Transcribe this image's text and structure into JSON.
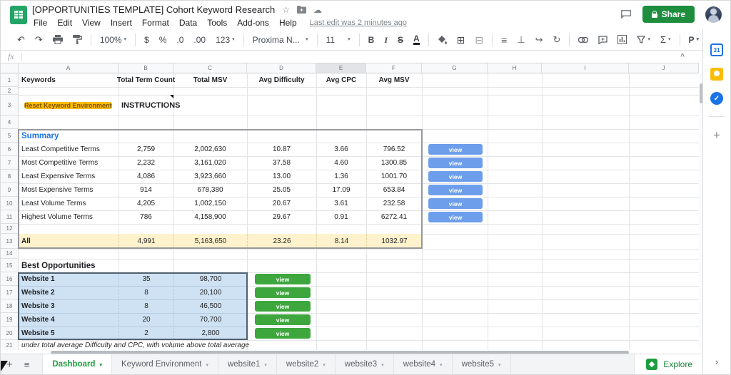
{
  "app": {
    "title": "[OPPORTUNITIES TEMPLATE] Cohort Keyword Research",
    "menu_items": [
      "File",
      "Edit",
      "View",
      "Insert",
      "Format",
      "Data",
      "Tools",
      "Add-ons",
      "Help"
    ],
    "last_edit": "Last edit was 2 minutes ago",
    "share_label": "Share"
  },
  "toolbar": {
    "zoom_value": "100%",
    "currency": "$",
    "percent": "%",
    "decimal_decrease": ".0",
    "decimal_increase": ".00",
    "number_format": "123",
    "font_name": "Proxima N...",
    "font_size": "11",
    "bold": "B",
    "italic": "I",
    "strikethrough": "S",
    "text_color": "A",
    "functions": "Σ",
    "addon": "P"
  },
  "formula_bar": {
    "label": "fx",
    "collapse": "^"
  },
  "grid": {
    "column_letters": [
      "A",
      "B",
      "C",
      "D",
      "E",
      "F",
      "G",
      "H",
      "I",
      "J"
    ],
    "selected_column": "E",
    "row_numbers": [
      "1",
      "2",
      "3",
      "4",
      "5",
      "6",
      "7",
      "8",
      "9",
      "10",
      "11",
      "12",
      "13",
      "14",
      "15",
      "16",
      "17",
      "18",
      "19",
      "20",
      "21"
    ]
  },
  "sheet": {
    "header_row": [
      "Keywords",
      "Total Term Count",
      "Total MSV",
      "Avg Difficulty",
      "Avg CPC",
      "Avg MSV"
    ],
    "reset_button_label": "Reset Keyword Environment",
    "instructions_label": "INSTRUCTIONS",
    "summary_title": "Summary",
    "view_button_label": "view",
    "summary_rows": [
      {
        "label": "Least Competitive Terms",
        "term_count": "2,759",
        "total_msv": "2,002,630",
        "avg_difficulty": "10.87",
        "avg_cpc": "3.66",
        "avg_msv": "796.52"
      },
      {
        "label": "Most Competitive Terms",
        "term_count": "2,232",
        "total_msv": "3,161,020",
        "avg_difficulty": "37.58",
        "avg_cpc": "4.60",
        "avg_msv": "1300.85"
      },
      {
        "label": "Least Expensive Terms",
        "term_count": "4,086",
        "total_msv": "3,923,660",
        "avg_difficulty": "13.00",
        "avg_cpc": "1.36",
        "avg_msv": "1001.70"
      },
      {
        "label": "Most Expensive Terms",
        "term_count": "914",
        "total_msv": "678,380",
        "avg_difficulty": "25.05",
        "avg_cpc": "17.09",
        "avg_msv": "653.84"
      },
      {
        "label": "Least Volume Terms",
        "term_count": "4,205",
        "total_msv": "1,002,150",
        "avg_difficulty": "20.67",
        "avg_cpc": "3.61",
        "avg_msv": "232.58"
      },
      {
        "label": "Highest Volume Terms",
        "term_count": "786",
        "total_msv": "4,158,900",
        "avg_difficulty": "29.67",
        "avg_cpc": "0.91",
        "avg_msv": "6272.41"
      }
    ],
    "all_row": {
      "label": "All",
      "term_count": "4,991",
      "total_msv": "5,163,650",
      "avg_difficulty": "23.26",
      "avg_cpc": "8.14",
      "avg_msv": "1032.97"
    },
    "best_title": "Best Opportunities",
    "best_rows": [
      {
        "label": "Website 1",
        "term_count": "35",
        "total_msv": "98,700"
      },
      {
        "label": "Website 2",
        "term_count": "8",
        "total_msv": "20,100"
      },
      {
        "label": "Website 3",
        "term_count": "8",
        "total_msv": "46,500"
      },
      {
        "label": "Website 4",
        "term_count": "20",
        "total_msv": "70,700"
      },
      {
        "label": "Website 5",
        "term_count": "2",
        "total_msv": "2,800"
      }
    ],
    "footnote": "under total average Difficulty and CPC, with volume above total average"
  },
  "tabs": {
    "items": [
      {
        "label": "Dashboard"
      },
      {
        "label": "Keyword Environment"
      },
      {
        "label": "website1"
      },
      {
        "label": "website2"
      },
      {
        "label": "website3"
      },
      {
        "label": "website4"
      },
      {
        "label": "website5"
      }
    ],
    "active_tab": "Dashboard"
  },
  "explore": {
    "label": "Explore"
  },
  "sidebar": {
    "calendar": "31",
    "tasks_check": "✓"
  },
  "colors": {
    "share_green": "#1e8e3e",
    "tab_active_green": "#1d9e3c",
    "summary_blue": "#1a73e8",
    "view_button_blue": "#6d9eeb",
    "view_button_green": "#3da63d",
    "reset_button_yellow": "#fbbc04",
    "all_row_background": "#fff2cc",
    "best_range_background": "#cfe2f3"
  }
}
